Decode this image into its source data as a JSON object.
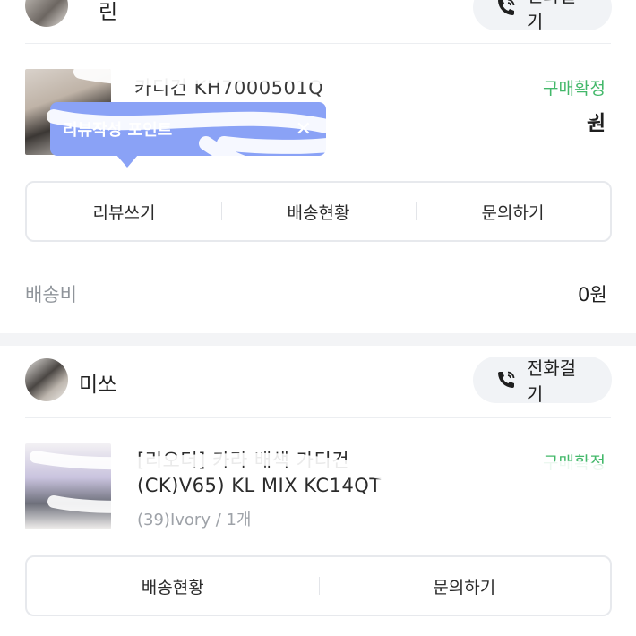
{
  "orders": [
    {
      "shop_name": "린",
      "call_label": "전화걸기",
      "status": "구매확정",
      "product_title": "카디건 KH7000501Q",
      "price": "원",
      "review_tooltip": "리뷰작성 포인트",
      "review_tooltip_close": "✕",
      "actions": [
        "리뷰쓰기",
        "배송현황",
        "문의하기"
      ],
      "shipping_fee_label": "배송비",
      "shipping_fee_value": "0원"
    },
    {
      "shop_name": "미쏘",
      "call_label": "전화걸기",
      "status": "구매확정",
      "product_title_line1": "[리오더] 카라 배색 가디건",
      "product_title_line2": "(CK)V65) KL MIX KC14QT",
      "option": "(39)Ivory / 1개",
      "actions": [
        "배송현황",
        "문의하기"
      ]
    }
  ],
  "colors": {
    "accent_green": "#43b86a",
    "tooltip_blue": "#8aa2f6",
    "button_bg": "#f1f3f6"
  },
  "icons": {
    "call": "phone-call-icon",
    "close": "close-icon"
  }
}
